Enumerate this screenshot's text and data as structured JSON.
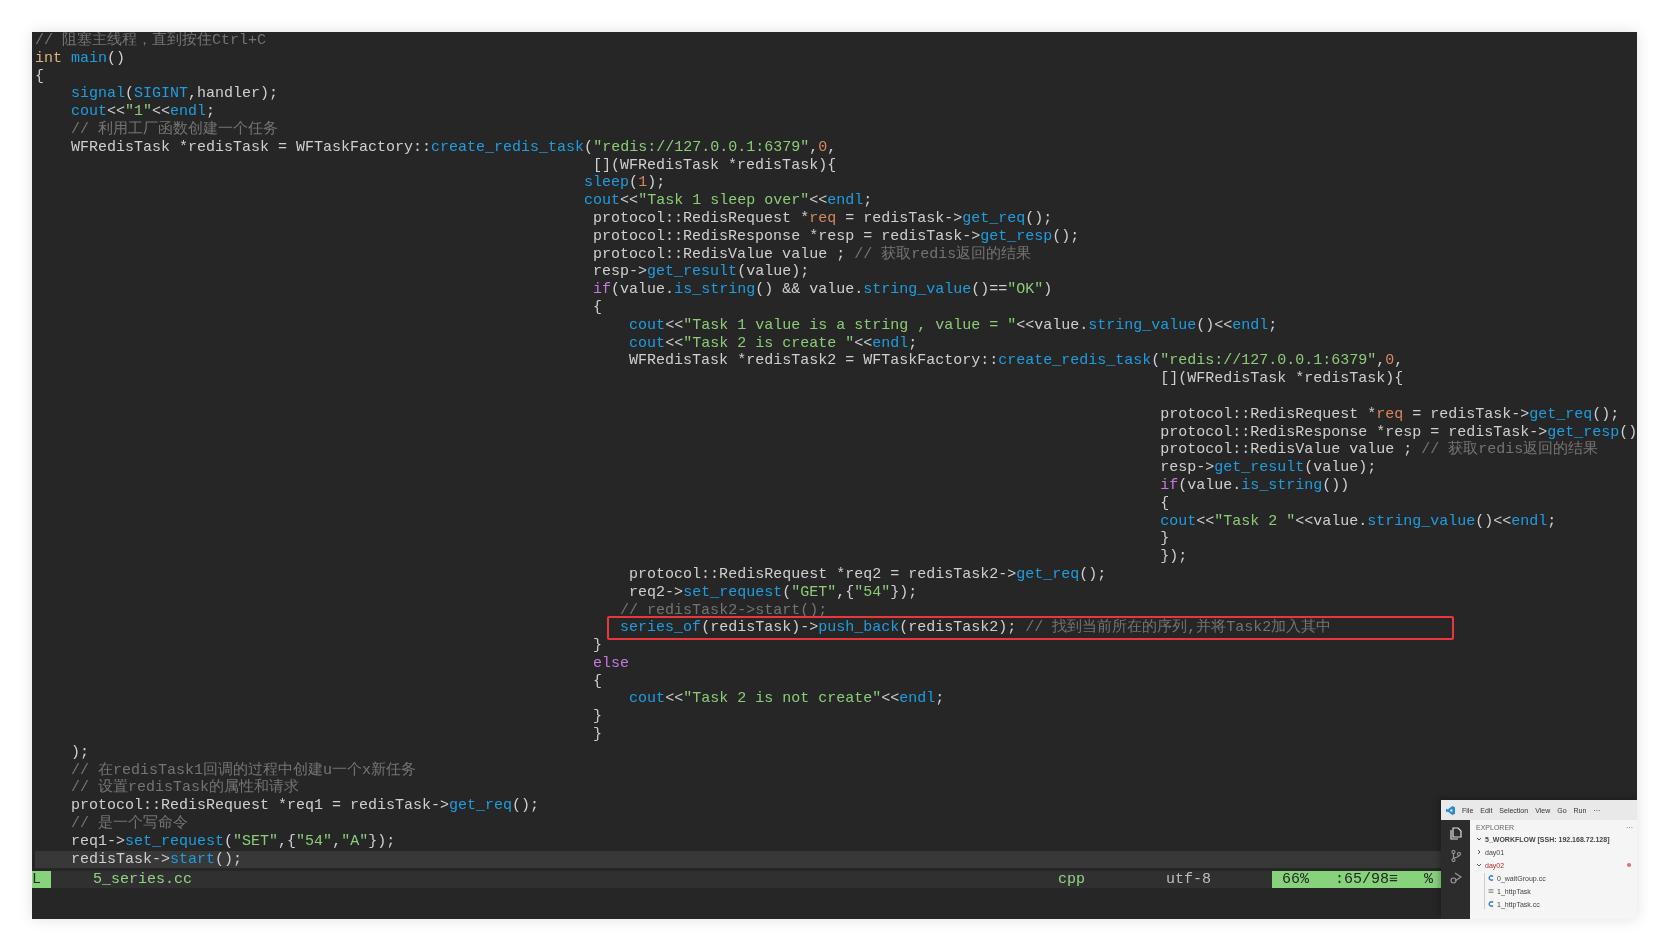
{
  "editor": {
    "lines": [
      {
        "kind": "code",
        "tokens": [
          {
            "kind": "cm",
            "text": "// 阻塞主线程，直到按住Ctrl+C"
          }
        ]
      },
      {
        "kind": "code",
        "tokens": [
          {
            "kind": "kw",
            "text": "int"
          },
          {
            "kind": "fn",
            "text": " main"
          },
          {
            "kind": "t",
            "text": "()"
          }
        ]
      },
      {
        "kind": "code",
        "tokens": [
          {
            "kind": "t",
            "text": "{"
          }
        ]
      },
      {
        "kind": "code",
        "tokens": [
          {
            "kind": "fn",
            "text": "    signal"
          },
          {
            "kind": "t",
            "text": "("
          },
          {
            "kind": "fn",
            "text": "SIGINT"
          },
          {
            "kind": "t",
            "text": ",handler);"
          }
        ]
      },
      {
        "kind": "code",
        "tokens": [
          {
            "kind": "fn",
            "text": "    cout"
          },
          {
            "kind": "t",
            "text": "<<"
          },
          {
            "kind": "str",
            "text": "\"1\""
          },
          {
            "kind": "t",
            "text": "<<"
          },
          {
            "kind": "fn",
            "text": "endl"
          },
          {
            "kind": "t",
            "text": ";"
          }
        ]
      },
      {
        "kind": "code",
        "tokens": [
          {
            "kind": "cm",
            "text": "    // 利用工厂函数创建一个任务"
          }
        ]
      },
      {
        "kind": "code",
        "tokens": [
          {
            "kind": "t",
            "text": "    WFRedisTask *redisTask = WFTaskFactory::"
          },
          {
            "kind": "fn",
            "text": "create_redis_task"
          },
          {
            "kind": "t",
            "text": "("
          },
          {
            "kind": "str",
            "text": "\"redis://127.0.0.1:6379\""
          },
          {
            "kind": "t",
            "text": ","
          },
          {
            "kind": "num",
            "text": "0"
          },
          {
            "kind": "t",
            "text": ","
          }
        ]
      },
      {
        "kind": "code",
        "tokens": [
          {
            "kind": "t",
            "text": "                                                              [](WFRedisTask *redisTask){"
          }
        ]
      },
      {
        "kind": "code",
        "tokens": [
          {
            "kind": "fn",
            "text": "                                                             sleep"
          },
          {
            "kind": "t",
            "text": "("
          },
          {
            "kind": "num",
            "text": "1"
          },
          {
            "kind": "t",
            "text": ");"
          }
        ]
      },
      {
        "kind": "code",
        "tokens": [
          {
            "kind": "fn",
            "text": "                                                             cout"
          },
          {
            "kind": "t",
            "text": "<<"
          },
          {
            "kind": "str",
            "text": "\"Task 1 sleep over\""
          },
          {
            "kind": "t",
            "text": "<<"
          },
          {
            "kind": "fn",
            "text": "endl"
          },
          {
            "kind": "t",
            "text": ";"
          }
        ]
      },
      {
        "kind": "code",
        "tokens": [
          {
            "kind": "t",
            "text": "                                                              protocol::RedisRequest *"
          },
          {
            "kind": "num",
            "text": "req"
          },
          {
            "kind": "t",
            "text": " = redisTask->"
          },
          {
            "kind": "fn",
            "text": "get_req"
          },
          {
            "kind": "t",
            "text": "();"
          }
        ]
      },
      {
        "kind": "code",
        "tokens": [
          {
            "kind": "t",
            "text": "                                                              protocol::RedisResponse *resp = redisTask->"
          },
          {
            "kind": "fn",
            "text": "get_resp"
          },
          {
            "kind": "t",
            "text": "();"
          }
        ]
      },
      {
        "kind": "code",
        "tokens": [
          {
            "kind": "t",
            "text": "                                                              protocol::RedisValue value ; "
          },
          {
            "kind": "cm",
            "text": "// 获取redis返回的结果"
          }
        ]
      },
      {
        "kind": "code",
        "tokens": [
          {
            "kind": "t",
            "text": "                                                              resp->"
          },
          {
            "kind": "fn",
            "text": "get_result"
          },
          {
            "kind": "t",
            "text": "(value);"
          }
        ]
      },
      {
        "kind": "code",
        "tokens": [
          {
            "kind": "ctl",
            "text": "                                                              if"
          },
          {
            "kind": "t",
            "text": "(value."
          },
          {
            "kind": "fn",
            "text": "is_string"
          },
          {
            "kind": "t",
            "text": "() && value."
          },
          {
            "kind": "fn",
            "text": "string_value"
          },
          {
            "kind": "t",
            "text": "()=="
          },
          {
            "kind": "str",
            "text": "\"OK\""
          },
          {
            "kind": "t",
            "text": ")"
          }
        ]
      },
      {
        "kind": "code",
        "tokens": [
          {
            "kind": "t",
            "text": "                                                              {"
          }
        ]
      },
      {
        "kind": "code",
        "tokens": [
          {
            "kind": "fn",
            "text": "                                                                  cout"
          },
          {
            "kind": "t",
            "text": "<<"
          },
          {
            "kind": "str",
            "text": "\"Task 1 value is a string , value = \""
          },
          {
            "kind": "t",
            "text": "<<value."
          },
          {
            "kind": "fn",
            "text": "string_value"
          },
          {
            "kind": "t",
            "text": "()<<"
          },
          {
            "kind": "fn",
            "text": "endl"
          },
          {
            "kind": "t",
            "text": ";"
          }
        ]
      },
      {
        "kind": "code",
        "tokens": [
          {
            "kind": "fn",
            "text": "                                                                  cout"
          },
          {
            "kind": "t",
            "text": "<<"
          },
          {
            "kind": "str",
            "text": "\"Task 2 is create \""
          },
          {
            "kind": "t",
            "text": "<<"
          },
          {
            "kind": "fn",
            "text": "endl"
          },
          {
            "kind": "t",
            "text": ";"
          }
        ]
      },
      {
        "kind": "code",
        "tokens": [
          {
            "kind": "t",
            "text": "                                                                  WFRedisTask *redisTask2 = WFTaskFactory::"
          },
          {
            "kind": "fn",
            "text": "create_redis_task"
          },
          {
            "kind": "t",
            "text": "("
          },
          {
            "kind": "str",
            "text": "\"redis://127.0.0.1:6379\""
          },
          {
            "kind": "t",
            "text": ","
          },
          {
            "kind": "num",
            "text": "0"
          },
          {
            "kind": "t",
            "text": ","
          }
        ]
      },
      {
        "kind": "code",
        "tokens": [
          {
            "kind": "t",
            "text": "                                                                                                                             [](WFRedisTask *redisTask){"
          }
        ]
      },
      {
        "kind": "blank"
      },
      {
        "kind": "code",
        "tokens": [
          {
            "kind": "t",
            "text": "                                                                                                                             protocol::RedisRequest *"
          },
          {
            "kind": "num",
            "text": "req"
          },
          {
            "kind": "t",
            "text": " = redisTask->"
          },
          {
            "kind": "fn",
            "text": "get_req"
          },
          {
            "kind": "t",
            "text": "();"
          }
        ]
      },
      {
        "kind": "code",
        "tokens": [
          {
            "kind": "t",
            "text": "                                                                                                                             protocol::RedisResponse *resp = redisTask->"
          },
          {
            "kind": "fn",
            "text": "get_resp"
          },
          {
            "kind": "t",
            "text": "()"
          }
        ]
      },
      {
        "kind": "code",
        "tokens": [
          {
            "kind": "t",
            "text": "                                                                                                                             protocol::RedisValue value ; "
          },
          {
            "kind": "cm",
            "text": "// 获取redis返回的结果"
          }
        ]
      },
      {
        "kind": "code",
        "tokens": [
          {
            "kind": "t",
            "text": "                                                                                                                             resp->"
          },
          {
            "kind": "fn",
            "text": "get_result"
          },
          {
            "kind": "t",
            "text": "(value);"
          }
        ]
      },
      {
        "kind": "code",
        "tokens": [
          {
            "kind": "ctl",
            "text": "                                                                                                                             if"
          },
          {
            "kind": "t",
            "text": "(value."
          },
          {
            "kind": "fn",
            "text": "is_string"
          },
          {
            "kind": "t",
            "text": "())"
          }
        ]
      },
      {
        "kind": "code",
        "tokens": [
          {
            "kind": "t",
            "text": "                                                                                                                             {"
          }
        ]
      },
      {
        "kind": "code",
        "tokens": [
          {
            "kind": "fn",
            "text": "                                                                                                                             cout"
          },
          {
            "kind": "t",
            "text": "<<"
          },
          {
            "kind": "str",
            "text": "\"Task 2 \""
          },
          {
            "kind": "t",
            "text": "<<value."
          },
          {
            "kind": "fn",
            "text": "string_value"
          },
          {
            "kind": "t",
            "text": "()<<"
          },
          {
            "kind": "fn",
            "text": "endl"
          },
          {
            "kind": "t",
            "text": ";"
          }
        ]
      },
      {
        "kind": "code",
        "tokens": [
          {
            "kind": "t",
            "text": "                                                                                                                             }"
          }
        ]
      },
      {
        "kind": "code",
        "tokens": [
          {
            "kind": "t",
            "text": "                                                                                                                             });"
          }
        ]
      },
      {
        "kind": "code",
        "tokens": [
          {
            "kind": "t",
            "text": "                                                                  protocol::RedisRequest *req2 = redisTask2->"
          },
          {
            "kind": "fn",
            "text": "get_req"
          },
          {
            "kind": "t",
            "text": "();"
          }
        ]
      },
      {
        "kind": "code",
        "tokens": [
          {
            "kind": "t",
            "text": "                                                                  req2->"
          },
          {
            "kind": "fn",
            "text": "set_request"
          },
          {
            "kind": "t",
            "text": "("
          },
          {
            "kind": "str",
            "text": "\"GET\""
          },
          {
            "kind": "t",
            "text": ",{"
          },
          {
            "kind": "str",
            "text": "\"54\""
          },
          {
            "kind": "t",
            "text": "});"
          }
        ]
      },
      {
        "kind": "code",
        "tokens": [
          {
            "kind": "cm",
            "text": "                                                                 // redisTask2->start();"
          }
        ]
      },
      {
        "kind": "code",
        "highlighted": true,
        "tokens": [
          {
            "kind": "fn",
            "text": "                                                                 series_of"
          },
          {
            "kind": "t",
            "text": "(redisTask)->"
          },
          {
            "kind": "fn",
            "text": "push_back"
          },
          {
            "kind": "t",
            "text": "(redisTask2); "
          },
          {
            "kind": "cm",
            "text": "// 找到当前所在的序列,并将Task2加入其中"
          }
        ]
      },
      {
        "kind": "code",
        "tokens": [
          {
            "kind": "t",
            "text": "                                                              }"
          }
        ]
      },
      {
        "kind": "code",
        "tokens": [
          {
            "kind": "ctl",
            "text": "                                                              else"
          }
        ]
      },
      {
        "kind": "code",
        "tokens": [
          {
            "kind": "t",
            "text": "                                                              {"
          }
        ]
      },
      {
        "kind": "code",
        "tokens": [
          {
            "kind": "fn",
            "text": "                                                                  cout"
          },
          {
            "kind": "t",
            "text": "<<"
          },
          {
            "kind": "str",
            "text": "\"Task 2 is not create\""
          },
          {
            "kind": "t",
            "text": "<<"
          },
          {
            "kind": "fn",
            "text": "endl"
          },
          {
            "kind": "t",
            "text": ";"
          }
        ]
      },
      {
        "kind": "code",
        "tokens": [
          {
            "kind": "t",
            "text": "                                                              }"
          }
        ]
      },
      {
        "kind": "code",
        "tokens": [
          {
            "kind": "t",
            "text": "                                                              }"
          }
        ]
      },
      {
        "kind": "code",
        "tokens": [
          {
            "kind": "t",
            "text": "    );"
          }
        ]
      },
      {
        "kind": "code",
        "tokens": [
          {
            "kind": "cm",
            "text": "    // 在redisTask1回调的过程中创建u一个x新任务"
          }
        ]
      },
      {
        "kind": "code",
        "tokens": [
          {
            "kind": "cm",
            "text": "    // 设置redisTask的属性和请求"
          }
        ]
      },
      {
        "kind": "code",
        "tokens": [
          {
            "kind": "t",
            "text": "    protocol::RedisRequest *req1 = redisTask->"
          },
          {
            "kind": "fn",
            "text": "get_req"
          },
          {
            "kind": "t",
            "text": "();"
          }
        ]
      },
      {
        "kind": "code",
        "tokens": [
          {
            "kind": "cm",
            "text": "    // 是一个写命令"
          }
        ]
      },
      {
        "kind": "code",
        "tokens": [
          {
            "kind": "t",
            "text": "    req1->"
          },
          {
            "kind": "fn",
            "text": "set_request"
          },
          {
            "kind": "t",
            "text": "("
          },
          {
            "kind": "str",
            "text": "\"SET\""
          },
          {
            "kind": "t",
            "text": ",{"
          },
          {
            "kind": "str",
            "text": "\"54\""
          },
          {
            "kind": "t",
            "text": ","
          },
          {
            "kind": "str",
            "text": "\"A\""
          },
          {
            "kind": "t",
            "text": "});"
          }
        ]
      },
      {
        "kind": "code",
        "current": true,
        "tokens": [
          {
            "kind": "t",
            "text": "    redisTask->"
          },
          {
            "kind": "fn",
            "text": "start"
          },
          {
            "kind": "t",
            "text": "();"
          }
        ]
      }
    ]
  },
  "status_bar": {
    "mode": "L",
    "filename": "5_series.cc",
    "filetype": "cpp",
    "encoding": "utf-8",
    "percent": "66%",
    "position": ":65/98≡",
    "percent_sign": "%"
  },
  "vscode_preview": {
    "menu": [
      "File",
      "Edit",
      "Selection",
      "View",
      "Go",
      "Run"
    ],
    "menu_more": "···",
    "explorer": {
      "title": "EXPLORER",
      "more": "···",
      "workspace": "5_WORKFLOW [SSH: 192.168.72.128]",
      "workspace_expanded": true,
      "folders": [
        {
          "label": "day01",
          "expanded": false,
          "modified": false
        },
        {
          "label": "day02",
          "expanded": true,
          "modified": true,
          "children": [
            {
              "label": "0_waitGroup.cc",
              "kind": "cpp"
            },
            {
              "label": "1_httpTask",
              "kind": "plain"
            },
            {
              "label": "1_httpTask.cc",
              "kind": "cpp"
            }
          ]
        }
      ]
    }
  }
}
